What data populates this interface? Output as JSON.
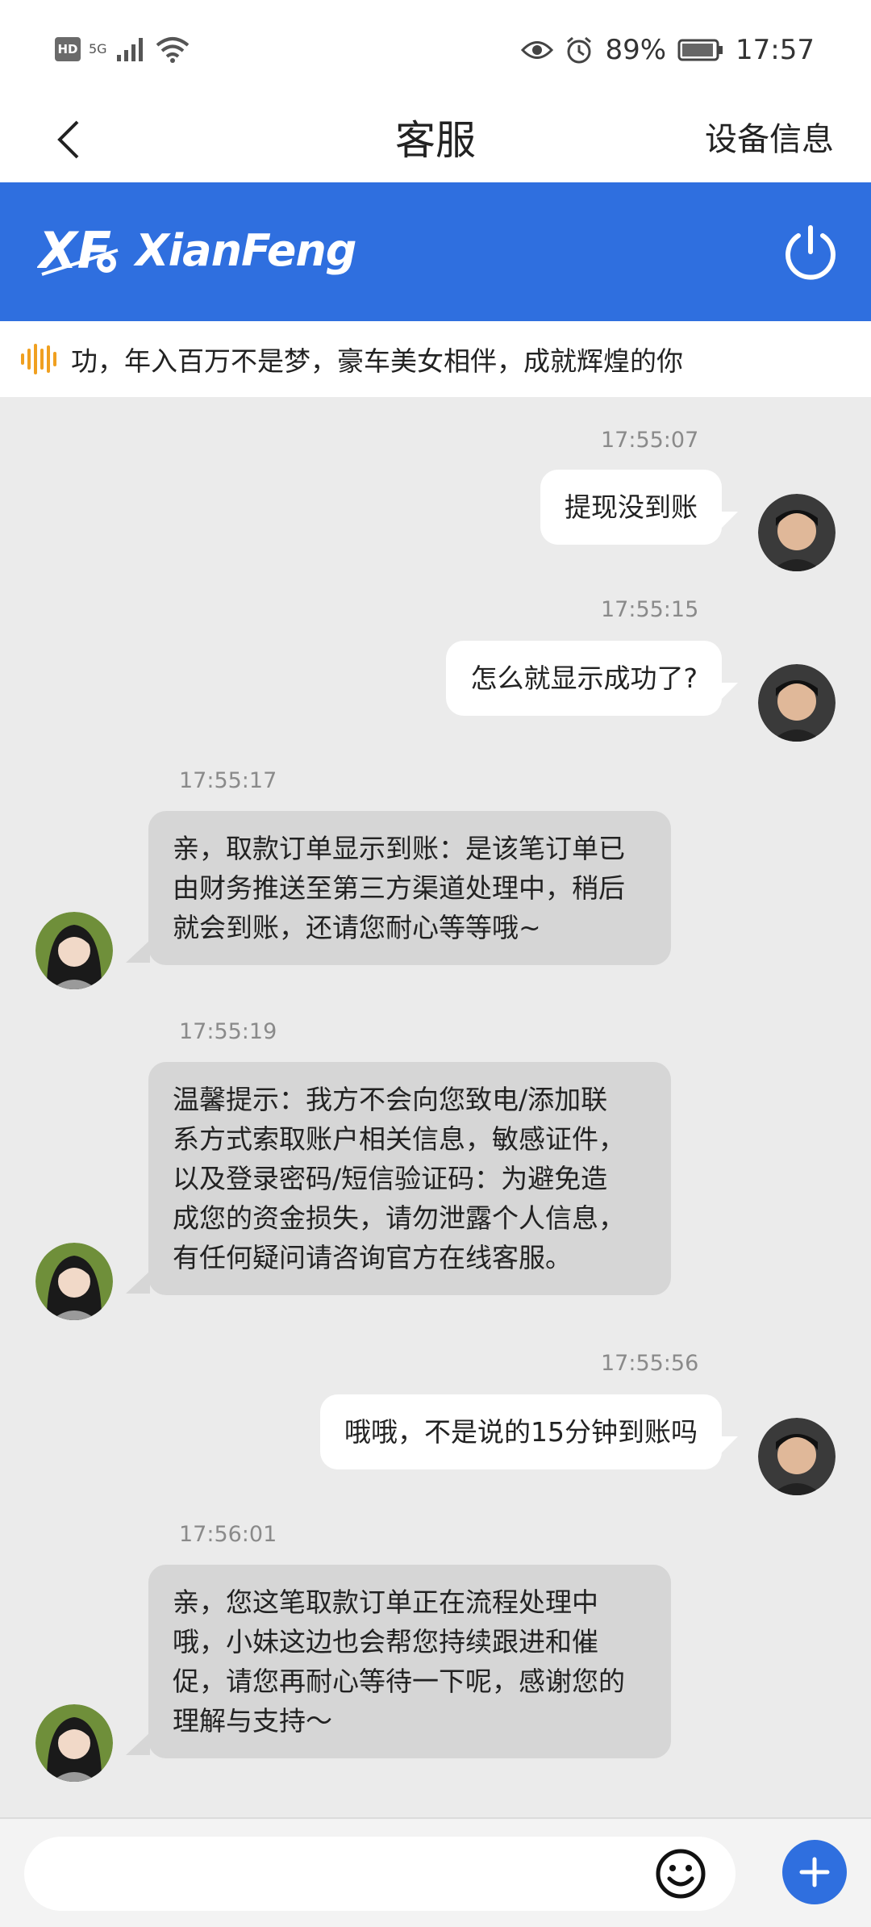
{
  "status_bar": {
    "hd": "HD",
    "network": "5G",
    "battery": "89%",
    "time": "17:57"
  },
  "nav": {
    "title": "客服",
    "right_label": "设备信息"
  },
  "brand": {
    "logo_text": "XF",
    "name": "XianFeng",
    "color": "#2f6fdf"
  },
  "marquee": {
    "text": "功，年入百万不是梦，豪车美女相伴，成就辉煌的你"
  },
  "messages": [
    {
      "side": "me",
      "time": "17:55:07",
      "text": "提现没到账"
    },
    {
      "side": "me",
      "time": "17:55:15",
      "text": "怎么就显示成功了?"
    },
    {
      "side": "cs",
      "time": "17:55:17",
      "lines": [
        "亲，取款订单显示到账：是该笔订单已",
        "由财务推送至第三方渠道处理中，稍后",
        "就会到账，还请您耐心等等哦~"
      ]
    },
    {
      "side": "cs",
      "time": "17:55:19",
      "lines": [
        "温馨提示：我方不会向您致电/添加联",
        "系方式索取账户相关信息，敏感证件，",
        "以及登录密码/短信验证码：为避免造",
        "成您的资金损失，请勿泄露个人信息，",
        "有任何疑问请咨询官方在线客服。"
      ]
    },
    {
      "side": "me",
      "time": "17:55:56",
      "text": "哦哦，不是说的15分钟到账吗"
    },
    {
      "side": "cs",
      "time": "17:56:01",
      "lines": [
        "亲，您这笔取款订单正在流程处理中",
        "哦，小妹这边也会帮您持续跟进和催",
        "促，请您再耐心等待一下呢，感谢您的",
        "理解与支持～"
      ]
    }
  ],
  "input": {
    "placeholder": ""
  },
  "icons": {
    "back": "chevron-left-icon",
    "power": "power-icon",
    "emoji": "smiley-icon",
    "plus": "plus-icon",
    "marquee": "sound-wave-icon"
  }
}
